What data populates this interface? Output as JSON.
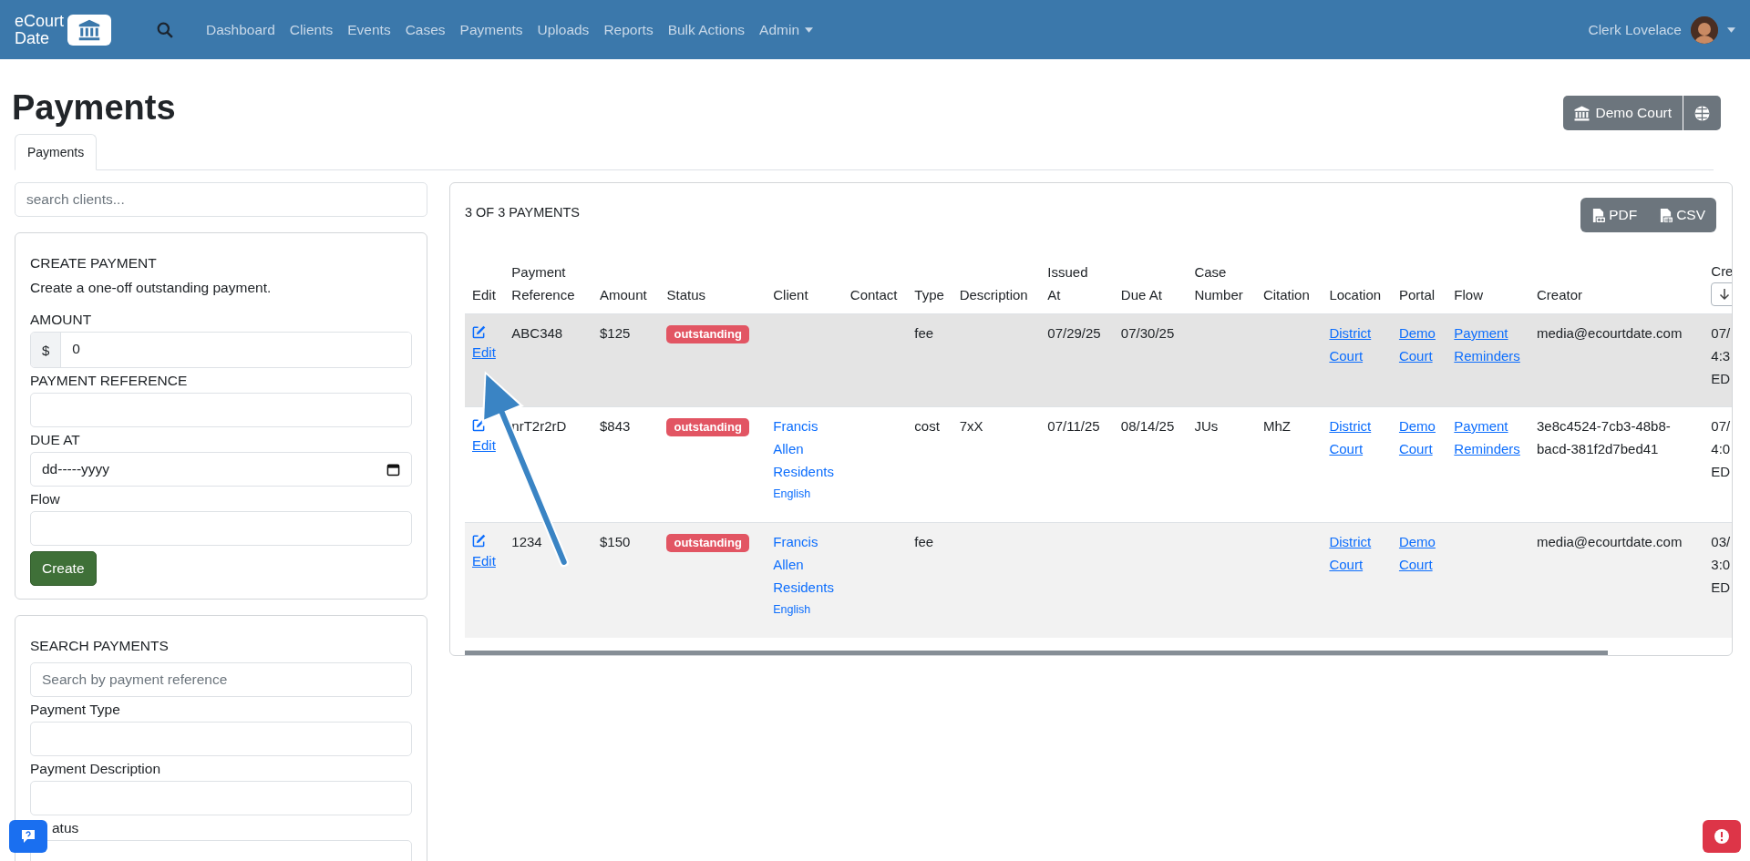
{
  "navbar": {
    "logo": [
      "eCourt",
      "Date"
    ],
    "links": [
      {
        "label": "Dashboard"
      },
      {
        "label": "Clients"
      },
      {
        "label": "Events"
      },
      {
        "label": "Cases"
      },
      {
        "label": "Payments"
      },
      {
        "label": "Uploads"
      },
      {
        "label": "Reports"
      },
      {
        "label": "Bulk Actions"
      },
      {
        "label": "Admin",
        "dropdown": true
      }
    ],
    "user": "Clerk Lovelace"
  },
  "page_title": "Payments",
  "header_buttons": {
    "portal": "Demo Court"
  },
  "tabs": [
    {
      "label": "Payments",
      "selected": true
    }
  ],
  "client_search": {
    "placeholder": "search clients..."
  },
  "create_payment": {
    "title": "CREATE PAYMENT",
    "description": "Create a one-off outstanding payment.",
    "amount_label": "AMOUNT",
    "amount_prefix": "$",
    "amount_value": "0",
    "reference_label": "PAYMENT REFERENCE",
    "due_label": "DUE AT",
    "due_value": "dd-----yyyy",
    "flow_label": "Flow",
    "button": "Create"
  },
  "search_payments": {
    "title": "SEARCH PAYMENTS",
    "placeholder": "Search by payment reference",
    "fields": [
      {
        "label": "Payment Type",
        "kind": "plain"
      },
      {
        "label": "Payment Description",
        "kind": "plain"
      },
      {
        "label": "atus",
        "kind": "covered"
      }
    ]
  },
  "payments": {
    "count": "3 OF 3 PAYMENTS",
    "export_buttons": [
      {
        "label": "PDF",
        "kind": "pdf"
      },
      {
        "label": "CSV",
        "kind": "csv"
      }
    ],
    "columns": [
      [
        "Edit"
      ],
      [
        "Payment",
        "Reference"
      ],
      [
        "Amount"
      ],
      [
        "Status"
      ],
      [
        "Client"
      ],
      [
        "Contact"
      ],
      [
        "Type"
      ],
      [
        "Description"
      ],
      [
        "Issued",
        "At"
      ],
      [
        "Due At"
      ],
      [
        "Case",
        "Number"
      ],
      [
        "Citation"
      ],
      [
        "Location"
      ],
      [
        "Portal"
      ],
      [
        "Flow"
      ],
      [
        "Creator"
      ],
      [
        "Cre"
      ]
    ],
    "rows": [
      {
        "hovered": true,
        "edit": "Edit",
        "reference": "ABC348",
        "amount": "$125",
        "status": "outstanding",
        "client": "",
        "client_language": "",
        "contact": "",
        "type": "fee",
        "description": "",
        "issued_at": "07/29/25",
        "due_at": "07/30/25",
        "case_number": "",
        "citation": "",
        "location": "District Court",
        "portal": "Demo Court",
        "flow": "Payment Reminders",
        "creator": "media@ecourtdate.com",
        "created": [
          "07/",
          "4:3",
          "ED"
        ]
      },
      {
        "hovered": false,
        "edit": "Edit",
        "reference": "nrT2r2rD",
        "amount": "$843",
        "status": "outstanding",
        "client": "Francis Allen Residents",
        "client_language": "English",
        "contact": "",
        "type": "cost",
        "description": "7xX",
        "issued_at": "07/11/25",
        "due_at": "08/14/25",
        "case_number": "JUs",
        "citation": "MhZ",
        "location": "District Court",
        "portal": "Demo Court",
        "flow": "Payment Reminders",
        "creator": "3e8c4524-7cb3-48b8-bacd-381f2d7bed41",
        "created": [
          "07/",
          "4:0",
          "ED"
        ]
      },
      {
        "hovered": false,
        "edit": "Edit",
        "reference": "1234",
        "amount": "$150",
        "status": "outstanding",
        "client": "Francis Allen Residents",
        "client_language": "English",
        "contact": "",
        "type": "fee",
        "description": "",
        "issued_at": "",
        "due_at": "",
        "case_number": "",
        "citation": "",
        "location": "District Court",
        "portal": "Demo Court",
        "flow": "",
        "creator": "media@ecourtdate.com",
        "created": [
          "03/",
          "3:0",
          "ED"
        ]
      }
    ]
  }
}
